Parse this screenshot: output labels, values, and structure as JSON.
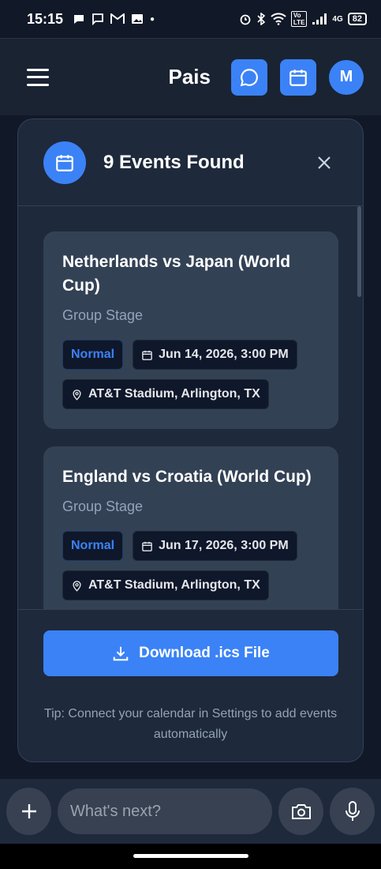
{
  "status_bar": {
    "time": "15:15",
    "battery": "82",
    "network": "4G"
  },
  "header": {
    "title": "Pais",
    "avatar_initial": "M"
  },
  "modal": {
    "title": "9 Events Found",
    "events": [
      {
        "title": "Netherlands vs Japan (World Cup)",
        "stage": "Group Stage",
        "priority": "Normal",
        "datetime": "Jun 14, 2026, 3:00 PM",
        "location": "AT&T Stadium, Arlington, TX"
      },
      {
        "title": "England vs Croatia (World Cup)",
        "stage": "Group Stage",
        "priority": "Normal",
        "datetime": "Jun 17, 2026, 3:00 PM",
        "location": "AT&T Stadium, Arlington, TX"
      }
    ],
    "download_label": "Download .ics File",
    "tip": "Tip: Connect your calendar in Settings to add events automatically"
  },
  "composer": {
    "placeholder": "What's next?"
  },
  "colors": {
    "accent": "#3b82f6",
    "background": "#111827",
    "card": "#334155",
    "panel": "#1e293b"
  }
}
